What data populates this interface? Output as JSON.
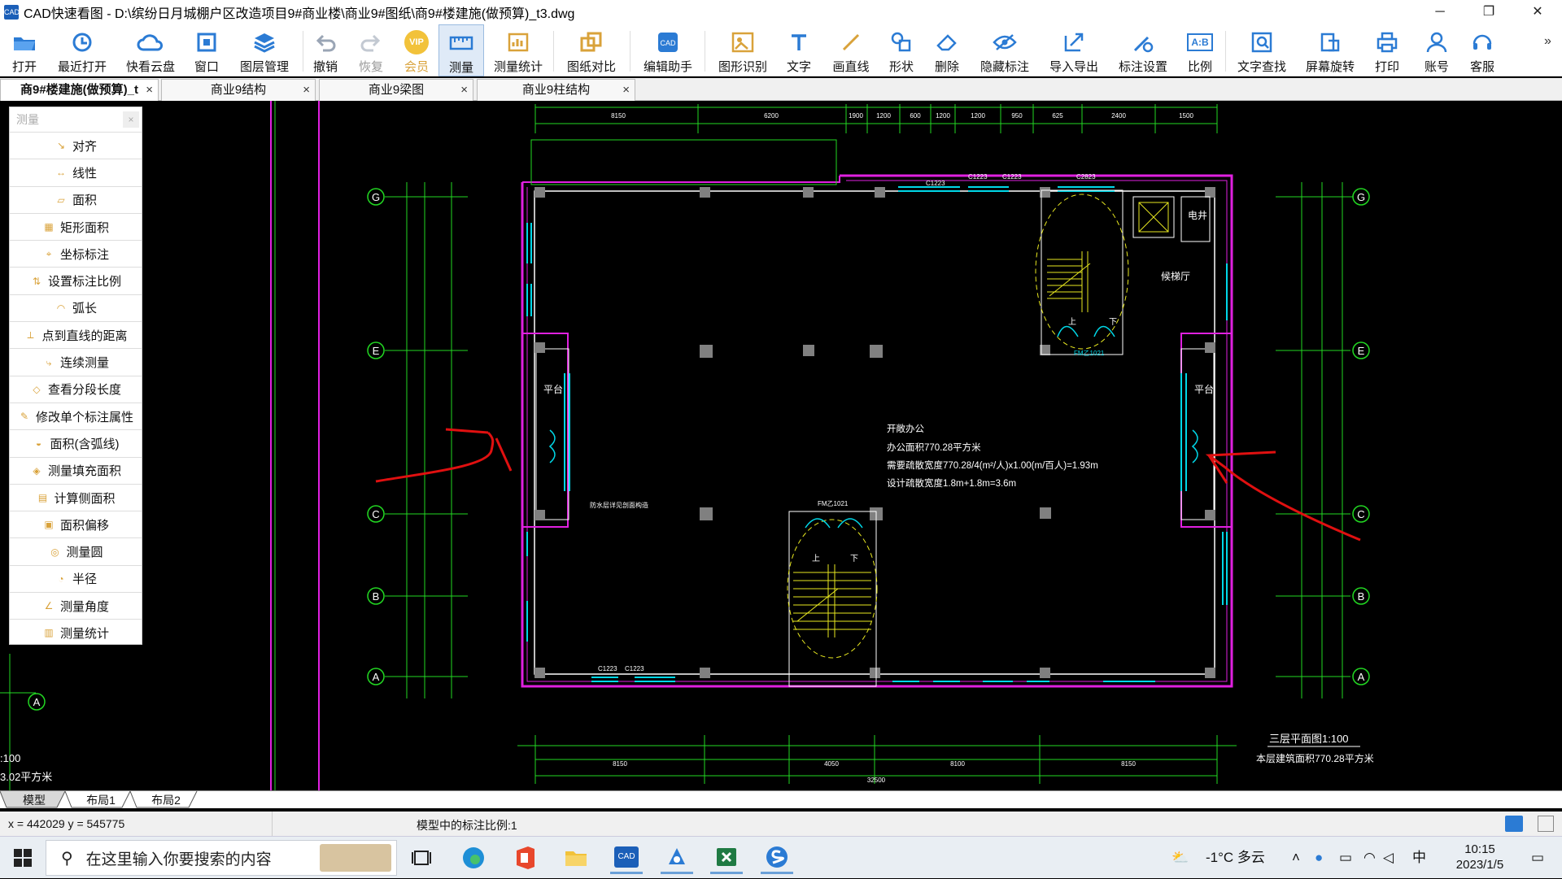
{
  "window": {
    "title": "CAD快速看图 - D:\\缤纷日月城棚户区改造项目9#商业楼\\商业9#图纸\\商9#楼建施(做预算)_t3.dwg",
    "app_icon_text": "CAD"
  },
  "toolbar": {
    "items": [
      {
        "label": "打开",
        "icon": "folder-open-icon"
      },
      {
        "label": "最近打开",
        "icon": "history-icon"
      },
      {
        "label": "快看云盘",
        "icon": "cloud-icon"
      },
      {
        "label": "窗口",
        "icon": "window-icon"
      },
      {
        "label": "图层管理",
        "icon": "layers-icon"
      },
      {
        "label": "撤销",
        "icon": "undo-icon"
      },
      {
        "label": "恢复",
        "icon": "redo-icon"
      },
      {
        "label": "会员",
        "icon": "vip-icon"
      },
      {
        "label": "测量",
        "icon": "ruler-icon"
      },
      {
        "label": "测量统计",
        "icon": "measure-stats-icon"
      },
      {
        "label": "图纸对比",
        "icon": "compare-icon"
      },
      {
        "label": "编辑助手",
        "icon": "edit-assistant-icon"
      },
      {
        "label": "图形识别",
        "icon": "shape-recognize-icon"
      },
      {
        "label": "文字",
        "icon": "text-icon"
      },
      {
        "label": "画直线",
        "icon": "line-icon"
      },
      {
        "label": "形状",
        "icon": "shape-icon"
      },
      {
        "label": "删除",
        "icon": "eraser-icon"
      },
      {
        "label": "隐藏标注",
        "icon": "hide-annotation-icon"
      },
      {
        "label": "导入导出",
        "icon": "import-export-icon"
      },
      {
        "label": "标注设置",
        "icon": "annotation-settings-icon"
      },
      {
        "label": "比例",
        "icon": "scale-icon"
      },
      {
        "label": "文字查找",
        "icon": "text-search-icon"
      },
      {
        "label": "屏幕旋转",
        "icon": "rotate-screen-icon"
      },
      {
        "label": "打印",
        "icon": "printer-icon"
      },
      {
        "label": "账号",
        "icon": "user-icon"
      },
      {
        "label": "客服",
        "icon": "headset-icon"
      }
    ],
    "vip_badge": "VIP",
    "scale_badge": "A:B",
    "overflow": "»"
  },
  "tabs": [
    {
      "label": "商9#楼建施(做预算)_t",
      "close": "×"
    },
    {
      "label": "商业9结构",
      "close": "×"
    },
    {
      "label": "商业9梁图",
      "close": "×"
    },
    {
      "label": "商业9柱结构",
      "close": "×"
    }
  ],
  "measure_panel": {
    "title": "测量",
    "close": "×",
    "items": [
      "对齐",
      "线性",
      "面积",
      "矩形面积",
      "坐标标注",
      "设置标注比例",
      "弧长",
      "点到直线的距离",
      "连续测量",
      "查看分段长度",
      "修改单个标注属性",
      "面积(含弧线)",
      "测量填充面积",
      "计算侧面积",
      "面积偏移",
      "测量圆",
      "半径",
      "测量角度",
      "测量统计"
    ]
  },
  "drawing": {
    "axis_labels": [
      "G",
      "E",
      "C",
      "B",
      "A"
    ],
    "left_axis_label": "A",
    "room_label_left": "平台",
    "room_label_right": "平台",
    "elevator_label": "候梯厅",
    "power_label": "电井",
    "note_line1": "开敞办公",
    "note_line2": "办公面积770.28平方米",
    "note_line3": "需要疏散宽度770.28/4(m²/人)x1.00(m/百人)=1.93m",
    "note_line4": "设计疏散宽度1.8m+1.8m=3.6m",
    "plan_title": "三层平面图1:100",
    "plan_area": "本层建筑面积770.28平方米",
    "left_text_1": ":100",
    "left_text_2": "3.02平方米",
    "window_tags": [
      "C1223",
      "C1223",
      "C1223",
      "C2823",
      "C2823",
      "C1223"
    ],
    "door_tags": [
      "FM乙1021",
      "FM乙1021"
    ],
    "side_note": "防水层详见剖面构造",
    "stair_labels": [
      "上",
      "下"
    ],
    "top_dims": [
      "8150",
      "6200",
      "1900",
      "1200",
      "600",
      "1200",
      "1200",
      "950",
      "625",
      "2400",
      "1500"
    ],
    "bottom_dims": [
      "8150",
      "4050",
      "8100",
      "8150"
    ],
    "overall_dim": "32500"
  },
  "layout_tabs": [
    "模型",
    "布局1",
    "布局2"
  ],
  "status": {
    "coords": "x = 442029  y = 545775",
    "scale": "模型中的标注比例:1"
  },
  "taskbar": {
    "search_placeholder": "在这里输入你要搜索的内容",
    "weather": "-1°C 多云",
    "ime": "中",
    "time": "10:15",
    "date": "2023/1/5"
  },
  "colors": {
    "cad_green": "#22d822",
    "cad_magenta": "#e020e0",
    "cad_cyan": "#00d8e8",
    "cad_yellow": "#e8e820",
    "annotation_red": "#e01010",
    "toolbar_blue": "#2b7bd4"
  }
}
